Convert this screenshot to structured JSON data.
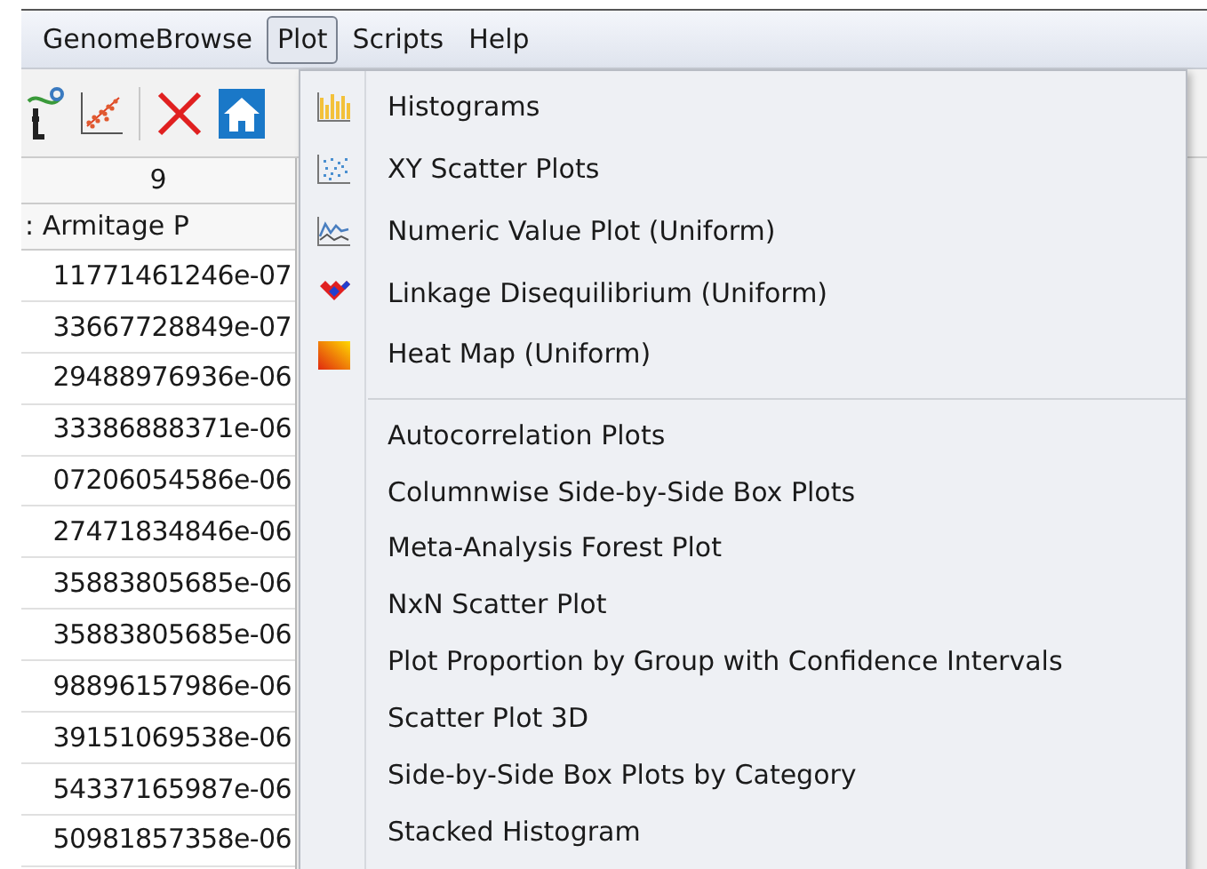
{
  "menubar": [
    {
      "label": "GenomeBrowse",
      "selected": false
    },
    {
      "label": "Plot",
      "selected": true
    },
    {
      "label": "Scripts",
      "selected": false
    },
    {
      "label": "Help",
      "selected": false
    }
  ],
  "table": {
    "header_rows": [
      "9",
      ": Armitage  P"
    ],
    "rows": [
      "11771461246e-07",
      "33667728849e-07",
      "29488976936e-06",
      "33386888371e-06",
      "07206054586e-06",
      "27471834846e-06",
      "35883805685e-06",
      "35883805685e-06",
      "98896157986e-06",
      "39151069538e-06",
      "54337165987e-06",
      "50981857358e-06"
    ]
  },
  "menu": {
    "groups": [
      {
        "items": [
          "Histograms",
          "XY Scatter Plots",
          "Numeric Value Plot (Uniform)",
          "Linkage Disequilibrium (Uniform)",
          "Heat Map (Uniform)"
        ]
      },
      {
        "items": [
          "Autocorrelation Plots",
          "Columnwise Side-by-Side Box Plots",
          "Meta-Analysis Forest Plot",
          "NxN Scatter Plot",
          "Plot Proportion by Group with Confidence Intervals",
          "Scatter Plot 3D",
          "Side-by-Side Box Plots by Category",
          "Stacked Histogram"
        ]
      }
    ]
  }
}
